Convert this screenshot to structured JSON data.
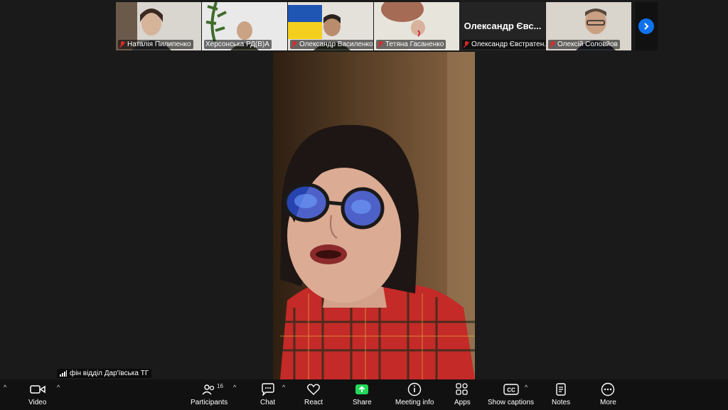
{
  "participants_strip": [
    {
      "name": "Наталія Пилипенко"
    },
    {
      "name": "Херсонська РД(В)А"
    },
    {
      "name": "Олександр Василенко..."
    },
    {
      "name": "Тетяна Гасаненко"
    },
    {
      "name": "Олександр Євстратен...",
      "display_title": "Олександр Євс..."
    },
    {
      "name": "Олексій Соловйов"
    }
  ],
  "speaker": {
    "label": "фін відділ Дар'ївська ТГ"
  },
  "toolbar": {
    "video": "Video",
    "participants": "Participants",
    "participants_count": "16",
    "chat": "Chat",
    "react": "React",
    "share": "Share",
    "meeting_info": "Meeting info",
    "apps": "Apps",
    "show_captions": "Show captions",
    "notes": "Notes",
    "more": "More"
  },
  "colors": {
    "accent": "#0e72ed",
    "share": "#23d959",
    "muted": "#e02828"
  }
}
